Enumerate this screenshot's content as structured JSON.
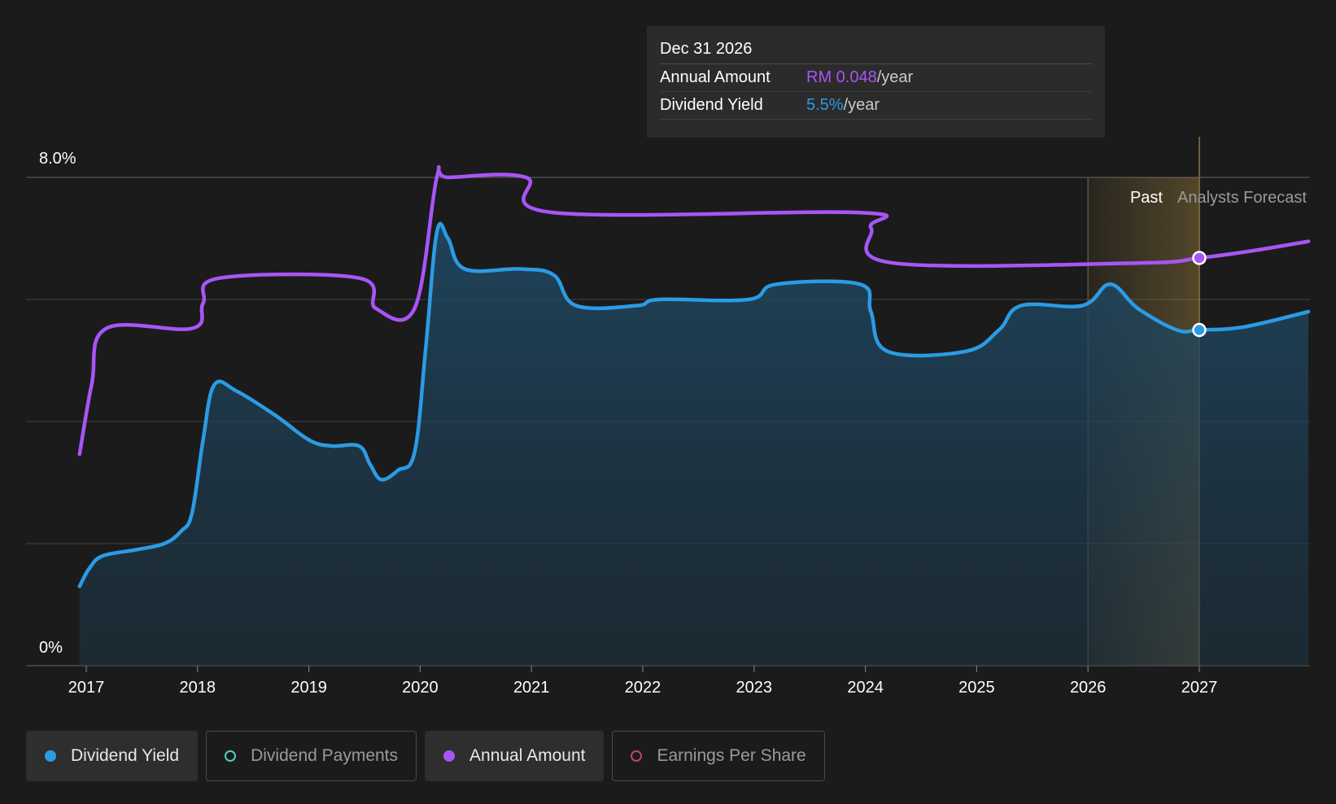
{
  "tooltip": {
    "date": "Dec 31 2026",
    "rows": [
      {
        "label": "Annual Amount",
        "value": "RM 0.048",
        "suffix": "/year",
        "color": "#a855f7"
      },
      {
        "label": "Dividend Yield",
        "value": "5.5%",
        "suffix": "/year",
        "color": "#2b9be4"
      }
    ]
  },
  "legend": [
    {
      "label": "Dividend Yield",
      "color": "#2b9be4",
      "active": true,
      "filled": true,
      "icon": "dividend-yield-dot-icon"
    },
    {
      "label": "Dividend Payments",
      "color": "#4fd1c5",
      "active": false,
      "filled": false,
      "icon": "dividend-payments-dot-icon"
    },
    {
      "label": "Annual Amount",
      "color": "#a855f7",
      "active": true,
      "filled": true,
      "icon": "annual-amount-dot-icon"
    },
    {
      "label": "Earnings Per Share",
      "color": "#c0407a",
      "active": false,
      "filled": false,
      "icon": "earnings-per-share-dot-icon"
    }
  ],
  "colors": {
    "background": "#1b1b1b",
    "dividend_yield": "#2b9be4",
    "annual_amount": "#a855f7",
    "forecast_band": "#c9a14a"
  },
  "chart_data": {
    "type": "line",
    "y_axis_labels": [
      "8.0%",
      "0%"
    ],
    "ylim": [
      0,
      8.0
    ],
    "grid": true,
    "xlim": [
      2016.94,
      2027.98
    ],
    "x_ticks": [
      "2017",
      "2018",
      "2019",
      "2020",
      "2021",
      "2022",
      "2023",
      "2024",
      "2025",
      "2026",
      "2027"
    ],
    "regions": {
      "past_label": "Past",
      "forecast_label": "Analysts Forecast",
      "past_start": 2026.0,
      "divider": 2027.0
    },
    "series": [
      {
        "name": "Dividend Yield",
        "unit": "%",
        "color": "#2b9be4",
        "fill": true,
        "points": [
          [
            2016.94,
            1.3
          ],
          [
            2017.03,
            1.6
          ],
          [
            2017.15,
            1.8
          ],
          [
            2017.45,
            1.9
          ],
          [
            2017.7,
            2.0
          ],
          [
            2017.85,
            2.2
          ],
          [
            2017.95,
            2.5
          ],
          [
            2018.05,
            3.7
          ],
          [
            2018.15,
            4.6
          ],
          [
            2018.35,
            4.5
          ],
          [
            2018.7,
            4.1
          ],
          [
            2019.0,
            3.7
          ],
          [
            2019.2,
            3.6
          ],
          [
            2019.45,
            3.6
          ],
          [
            2019.55,
            3.3
          ],
          [
            2019.65,
            3.05
          ],
          [
            2019.8,
            3.2
          ],
          [
            2019.95,
            3.5
          ],
          [
            2020.05,
            5.2
          ],
          [
            2020.15,
            7.1
          ],
          [
            2020.25,
            7.0
          ],
          [
            2020.4,
            6.5
          ],
          [
            2020.9,
            6.5
          ],
          [
            2021.2,
            6.4
          ],
          [
            2021.4,
            5.9
          ],
          [
            2021.95,
            5.9
          ],
          [
            2022.15,
            6.0
          ],
          [
            2022.95,
            6.0
          ],
          [
            2023.2,
            6.25
          ],
          [
            2023.95,
            6.25
          ],
          [
            2024.05,
            5.8
          ],
          [
            2024.2,
            5.15
          ],
          [
            2024.9,
            5.15
          ],
          [
            2025.2,
            5.5
          ],
          [
            2025.4,
            5.9
          ],
          [
            2025.95,
            5.9
          ],
          [
            2026.2,
            6.25
          ],
          [
            2026.45,
            5.85
          ],
          [
            2026.8,
            5.5
          ],
          [
            2027.0,
            5.5
          ],
          [
            2027.4,
            5.55
          ],
          [
            2027.98,
            5.8
          ]
        ]
      },
      {
        "name": "Annual Amount",
        "unit": "RM",
        "color": "#a855f7",
        "fill": false,
        "points": [
          [
            2016.94,
            0.042
          ],
          [
            2017.05,
            0.056
          ],
          [
            2017.18,
            0.067
          ],
          [
            2017.95,
            0.067
          ],
          [
            2018.05,
            0.072
          ],
          [
            2018.2,
            0.077
          ],
          [
            2019.45,
            0.077
          ],
          [
            2019.6,
            0.071
          ],
          [
            2019.95,
            0.071
          ],
          [
            2020.15,
            0.097
          ],
          [
            2020.25,
            0.097
          ],
          [
            2020.95,
            0.097
          ],
          [
            2021.2,
            0.09
          ],
          [
            2023.95,
            0.09
          ],
          [
            2024.05,
            0.087
          ],
          [
            2024.25,
            0.08
          ],
          [
            2026.45,
            0.08
          ],
          [
            2027.0,
            0.081
          ],
          [
            2027.5,
            0.0825
          ],
          [
            2027.98,
            0.0843
          ]
        ]
      }
    ],
    "markers": [
      {
        "series": "Annual Amount",
        "x": 2027.0,
        "value": 0.048
      },
      {
        "series": "Dividend Yield",
        "x": 2027.0,
        "value": 5.5
      }
    ]
  }
}
